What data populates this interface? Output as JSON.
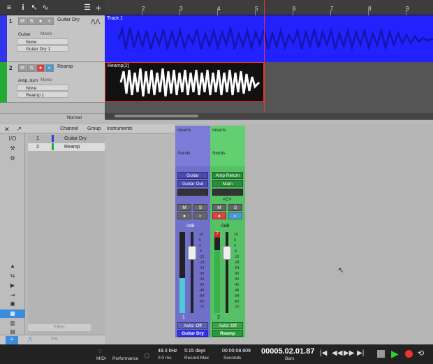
{
  "toolbar": {
    "icons": [
      "menu-icon",
      "info-icon",
      "arrow-icon",
      "automation-icon",
      "list-icon",
      "add-icon"
    ]
  },
  "ruler": {
    "marks": [
      "2",
      "3",
      "4",
      "5",
      "6",
      "7",
      "8",
      "9"
    ]
  },
  "tracks": [
    {
      "num": "1",
      "m": "M",
      "s": "S",
      "name": "Guitar Dry",
      "input": "Guitar",
      "mono": "Mono",
      "send": "None",
      "output": "Guitar Dry 1",
      "color": "#3333ee"
    },
    {
      "num": "2",
      "m": "M",
      "s": "S",
      "name": "Reamp",
      "input": "Amp..turn",
      "mono": "Mono",
      "send": "None",
      "output": "Reamp 1",
      "color": "#22aa33"
    }
  ],
  "clips": {
    "track1": "Track 1",
    "track2": "Reamp(2)"
  },
  "trackfoot": {
    "mode": "Normal"
  },
  "mixer": {
    "headers": {
      "channel": "Channel",
      "group": "Group",
      "instruments": "Instruments"
    },
    "io": "I/O",
    "list": [
      {
        "num": "1",
        "name": "Guitar Dry"
      },
      {
        "num": "2",
        "name": "Reamp"
      }
    ],
    "filter": "Filter",
    "strips": [
      {
        "inserts": "Inserts",
        "sends": "Sends",
        "input": "Guitar",
        "output": "Guitar Out",
        "pan": "",
        "m": "M",
        "s": "S",
        "vol": "0dB",
        "num": "1",
        "auto": "Auto: Off",
        "name": "Guitar Dry",
        "scale": [
          "10",
          "6",
          "0",
          "-6",
          "-12",
          "-18",
          "-24",
          "-30",
          "-36",
          "-42",
          "-48",
          "-54",
          "-60",
          "-72"
        ]
      },
      {
        "inserts": "Inserts",
        "sends": "Sends",
        "input": "Amp Return",
        "output": "Main",
        "pan": "<C>",
        "m": "M",
        "s": "S",
        "vol": "0dB",
        "num": "2",
        "auto": "Auto: Off",
        "name": "Reamp",
        "clip": "7",
        "scale": [
          "10",
          "6",
          "0",
          "-6",
          "-12",
          "-18",
          "-24",
          "-30",
          "-36",
          "-42",
          "-48",
          "-54",
          "-60",
          "-72"
        ]
      }
    ]
  },
  "transport": {
    "midi": "MIDI",
    "perf": "Performance",
    "rate": "48.0 kHz",
    "rate_sub": "0.0 ms",
    "record_time": "5:15 days",
    "record_label": "Record Max",
    "seconds": "00:00:08.609",
    "seconds_label": "Seconds",
    "bars": "00005.02.01.87",
    "bars_label": "Bars"
  }
}
